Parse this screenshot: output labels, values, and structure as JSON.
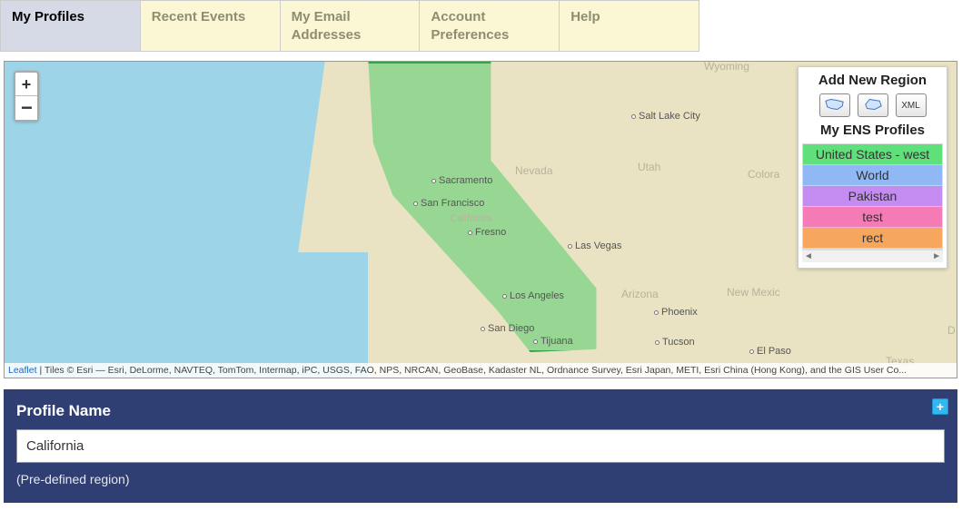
{
  "tabs": [
    {
      "label": "My Profiles",
      "active": true
    },
    {
      "label": "Recent Events",
      "active": false
    },
    {
      "label": "My Email Addresses",
      "active": false
    },
    {
      "label": "Account Preferences",
      "active": false
    },
    {
      "label": "Help",
      "active": false
    }
  ],
  "map": {
    "attribution_link": "Leaflet",
    "attribution_rest": " | Tiles © Esri — Esri, DeLorme, NAVTEQ, TomTom, Intermap, iPC, USGS, FAO, NPS, NRCAN, GeoBase, Kadaster NL, Ordnance Survey, Esri Japan, METI, Esri China (Hong Kong), and the GIS User Co...",
    "cities": {
      "sacramento": "Sacramento",
      "san_francisco": "San Francisco",
      "california": "California",
      "fresno": "Fresno",
      "los_angeles": "Los Angeles",
      "san_diego": "San Diego",
      "tijuana": "Tijuana",
      "las_vegas": "Las Vegas",
      "phoenix": "Phoenix",
      "tucson": "Tucson",
      "el_paso": "El Paso",
      "salt_lake": "Salt Lake City"
    },
    "states": {
      "nevada": "Nevada",
      "utah": "Utah",
      "arizona": "Arizona",
      "colorado": "Colora",
      "new_mexico": "New Mexic",
      "wyoming": "Wyoming",
      "texas": "Texas",
      "d": "D"
    }
  },
  "panel": {
    "add_title": "Add New Region",
    "xml_label": "XML",
    "profiles_title": "My ENS Profiles",
    "items": [
      {
        "label": "United States - west",
        "color": "#5fe07a"
      },
      {
        "label": "World",
        "color": "#8fb8f4"
      },
      {
        "label": "Pakistan",
        "color": "#c48cf0"
      },
      {
        "label": "test",
        "color": "#f47bb6"
      },
      {
        "label": "rect",
        "color": "#f7a65e"
      }
    ]
  },
  "form": {
    "title": "Profile Name",
    "value": "California",
    "hint": "(Pre-defined region)"
  }
}
